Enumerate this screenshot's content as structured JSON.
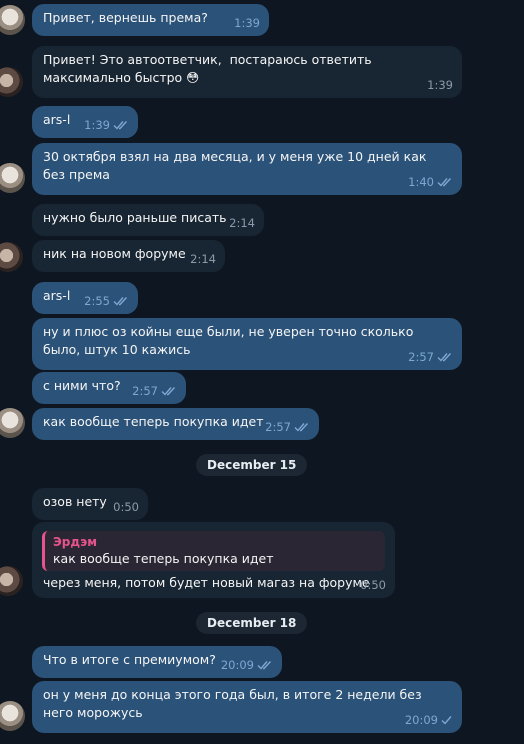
{
  "messages": [
    {
      "text": "Привет, вернешь према?",
      "time": "1:39"
    },
    {
      "text": "Привет! Это автоответчик,  постараюсь ответить максимально быстро 😳",
      "time": "1:39"
    },
    {
      "text": "ars-l",
      "time": "1:39"
    },
    {
      "text": "30 октября взял на два месяца, и у меня уже 10 дней как без према",
      "time": "1:40"
    },
    {
      "text": "нужно было раньше писать",
      "time": "2:14"
    },
    {
      "text": "ник на новом форуме",
      "time": "2:14"
    },
    {
      "text": "ars-l",
      "time": "2:55"
    },
    {
      "text": "ну и плюс оз койны еще были, не уверен точно сколько было, штук 10 кажись",
      "time": "2:57"
    },
    {
      "text": "с ними что?",
      "time": "2:57"
    },
    {
      "text": "как вообще теперь покупка идет",
      "time": "2:57"
    },
    {
      "text": "озов нету",
      "time": "0:50"
    },
    {
      "reply_name": "Эрдэм",
      "reply_text": "как вообще теперь покупка идет",
      "text": "через меня, потом будет новый магаз на форуме",
      "time": "0:50"
    },
    {
      "text": "Что в итоге с премиумом?",
      "time": "20:09"
    },
    {
      "text": "он у меня до конца этого года был, в итоге 2 недели без него морожусь",
      "time": "20:09"
    }
  ],
  "dates": [
    "December 15",
    "December 18"
  ],
  "colors": {
    "incoming": "#182533",
    "outgoing": "#2b5278",
    "background": "#0e1621",
    "reply_accent": "#e5548a"
  }
}
